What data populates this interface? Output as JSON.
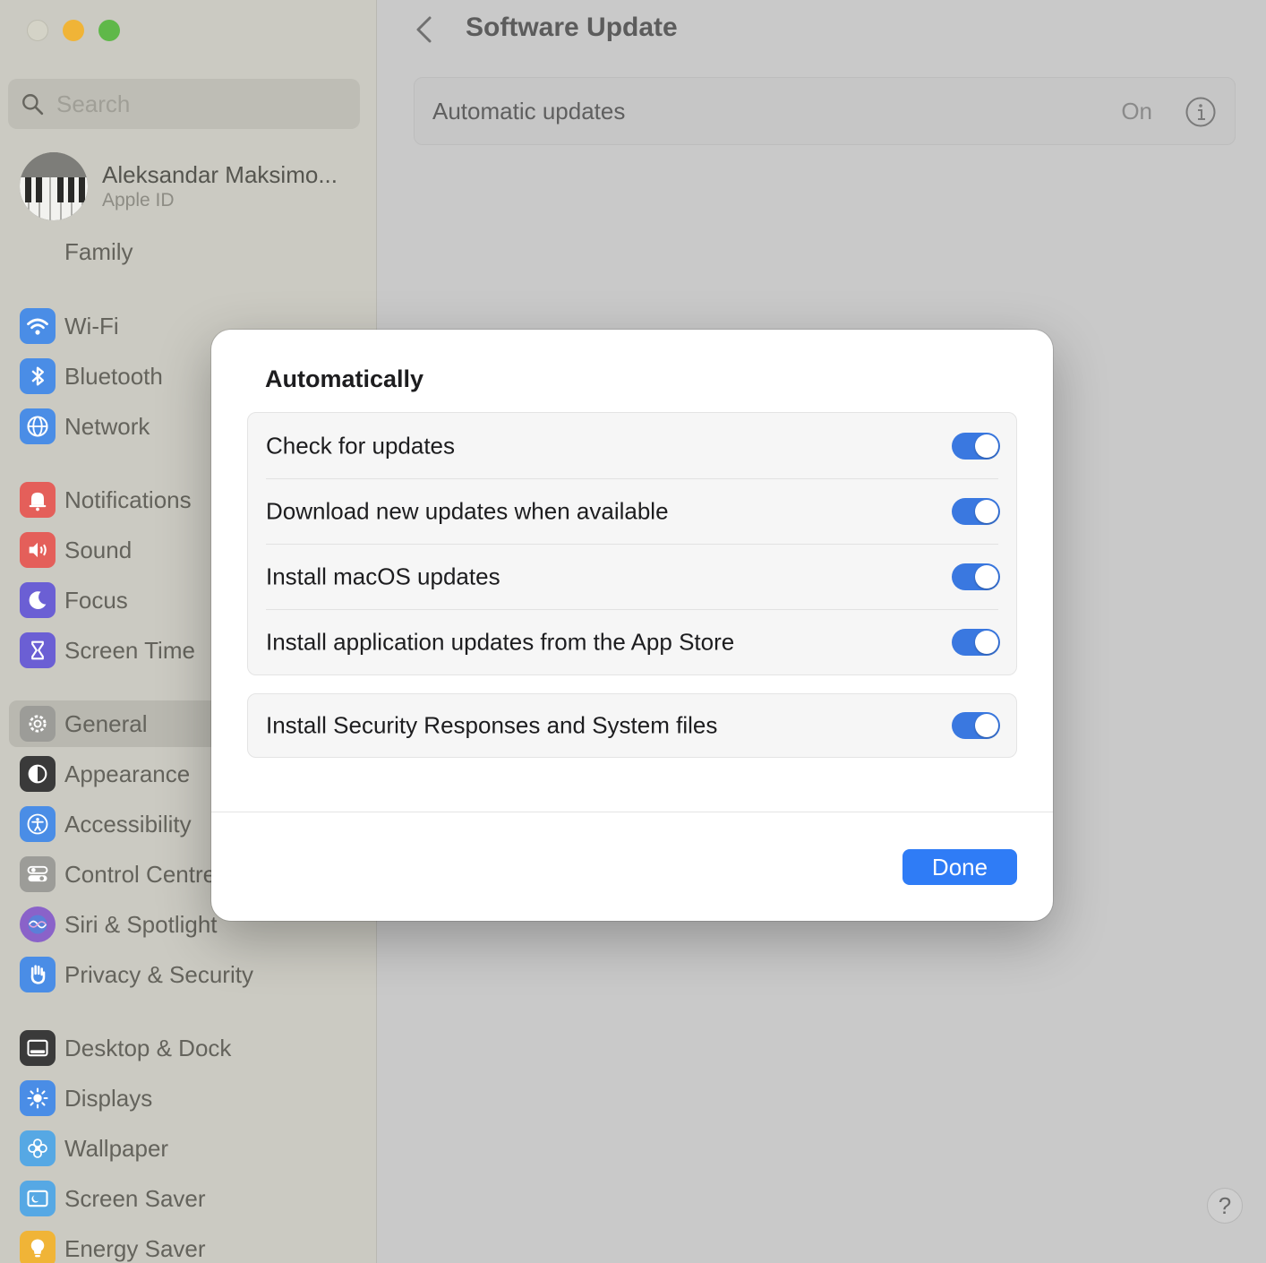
{
  "window": {
    "title": "Software Update"
  },
  "sidebar": {
    "search_placeholder": "Search",
    "profile": {
      "name": "Aleksandar Maksimo...",
      "subtitle": "Apple ID"
    },
    "family": "Family",
    "items": [
      {
        "label": "Wi-Fi",
        "icon": "wifi-icon",
        "color": "#4a8de6"
      },
      {
        "label": "Bluetooth",
        "icon": "bluetooth-icon",
        "color": "#4a8de6"
      },
      {
        "label": "Network",
        "icon": "globe-icon",
        "color": "#4a8de6"
      },
      {
        "label": "Notifications",
        "icon": "bell-icon",
        "color": "#e45f5a"
      },
      {
        "label": "Sound",
        "icon": "speaker-icon",
        "color": "#e45f5a"
      },
      {
        "label": "Focus",
        "icon": "moon-icon",
        "color": "#6b5fd4"
      },
      {
        "label": "Screen Time",
        "icon": "hourglass-icon",
        "color": "#6b5fd4"
      },
      {
        "label": "General",
        "icon": "gear-icon",
        "color": "#9c9c98"
      },
      {
        "label": "Appearance",
        "icon": "appearance-icon",
        "color": "#3a3a3a"
      },
      {
        "label": "Accessibility",
        "icon": "accessibility-icon",
        "color": "#4a8de6"
      },
      {
        "label": "Control Centre",
        "icon": "switches-icon",
        "color": "#9c9c98"
      },
      {
        "label": "Siri & Spotlight",
        "icon": "siri-icon",
        "color": "#8a62c9"
      },
      {
        "label": "Privacy & Security",
        "icon": "hand-icon",
        "color": "#4a8de6"
      },
      {
        "label": "Desktop & Dock",
        "icon": "dock-icon",
        "color": "#3a3a3a"
      },
      {
        "label": "Displays",
        "icon": "sun-icon",
        "color": "#4a8de6"
      },
      {
        "label": "Wallpaper",
        "icon": "flower-icon",
        "color": "#56a8e4"
      },
      {
        "label": "Screen Saver",
        "icon": "screensaver-icon",
        "color": "#56a8e4"
      },
      {
        "label": "Energy Saver",
        "icon": "bulb-icon",
        "color": "#f0b437"
      }
    ]
  },
  "main": {
    "automatic_updates": {
      "label": "Automatic updates",
      "value": "On"
    },
    "help_label": "?"
  },
  "dialog": {
    "title": "Automatically",
    "options": [
      {
        "label": "Check for updates",
        "enabled": true
      },
      {
        "label": "Download new updates when available",
        "enabled": true
      },
      {
        "label": "Install macOS updates",
        "enabled": true
      },
      {
        "label": "Install application updates from the App Store",
        "enabled": true
      }
    ],
    "security": {
      "label": "Install Security Responses and System files",
      "enabled": true
    },
    "done_label": "Done"
  },
  "colors": {
    "accent": "#2f7cf6",
    "toggle_on": "#3a78e0"
  }
}
